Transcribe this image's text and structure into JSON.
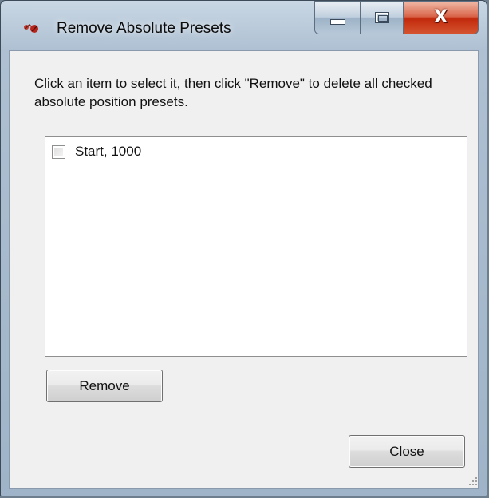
{
  "window": {
    "title": "Remove Absolute Presets",
    "icon": "app-logo-icon",
    "caption_buttons": {
      "minimize_icon": "minimize-icon",
      "maximize_icon": "maximize-icon",
      "close_glyph": "X"
    }
  },
  "dialog": {
    "instruction": "Click an item to select it, then click \"Remove\" to delete all checked absolute position presets.",
    "presets": [
      {
        "label": "Start, 1000",
        "checked": false
      }
    ],
    "remove_label": "Remove",
    "close_label": "Close"
  },
  "colors": {
    "close_button": "#c22a0c",
    "client_background": "#f0f0f0",
    "frame": "#aec0d2"
  }
}
